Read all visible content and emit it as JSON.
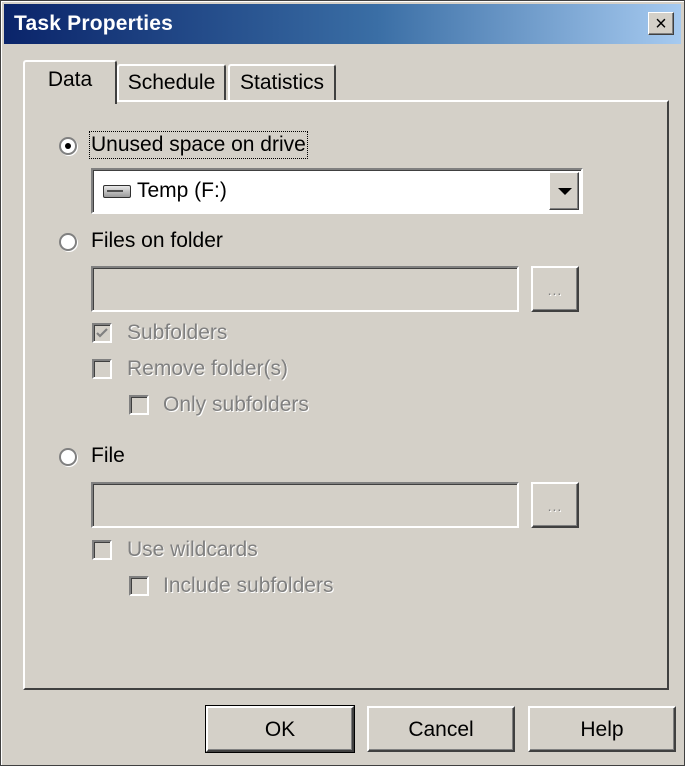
{
  "window": {
    "title": "Task Properties",
    "close_glyph": "×"
  },
  "tabs": [
    {
      "label": "Data",
      "active": true
    },
    {
      "label": "Schedule",
      "active": false
    },
    {
      "label": "Statistics",
      "active": false
    }
  ],
  "unused_space": {
    "label": "Unused space on drive",
    "selected": true,
    "drive": {
      "icon": "drive-icon",
      "value": "Temp (F:)"
    }
  },
  "files_on_folder": {
    "label": "Files on folder",
    "selected": false,
    "path_value": "",
    "browse_label": "...",
    "subfolders": {
      "label": "Subfolders",
      "checked": true
    },
    "remove_folders": {
      "label": "Remove folder(s)",
      "checked": false
    },
    "only_subfolders": {
      "label": "Only subfolders",
      "checked": false
    }
  },
  "file": {
    "label": "File",
    "selected": false,
    "path_value": "",
    "browse_label": "...",
    "use_wildcards": {
      "label": "Use wildcards",
      "checked": false
    },
    "include_subfolders": {
      "label": "Include subfolders",
      "checked": false
    }
  },
  "buttons": {
    "ok": "OK",
    "cancel": "Cancel",
    "help": "Help"
  },
  "colors": {
    "face": "#d4d0c8",
    "title_start": "#0a246a",
    "title_end": "#a6caf0",
    "disabled_text": "#808080"
  }
}
